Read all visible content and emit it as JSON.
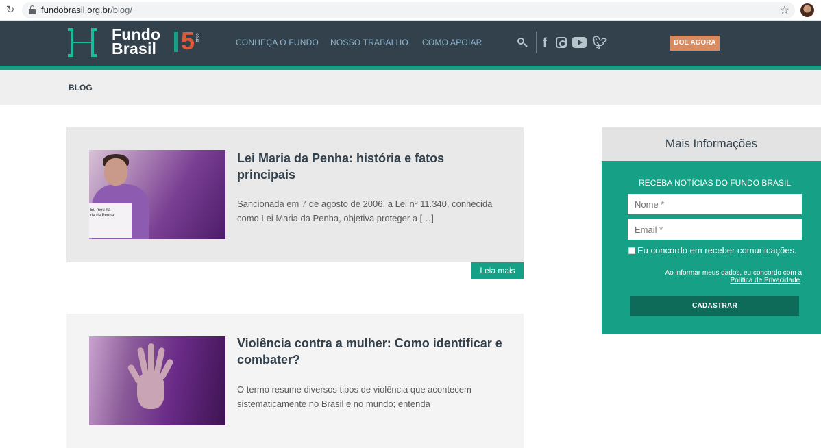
{
  "browser": {
    "url_host": "fundobrasil.org.br",
    "url_path": "/blog/"
  },
  "header": {
    "logo_line1": "Fundo",
    "logo_line2": "Brasil",
    "logo_years": "15",
    "logo_anos": "anos",
    "nav": [
      "CONHEÇA O FUNDO",
      "NOSSO TRABALHO",
      "COMO APOIAR"
    ],
    "social_icons": [
      "facebook-icon",
      "instagram-icon",
      "youtube-icon",
      "twitter-icon"
    ],
    "donate_label": "DOE AGORA"
  },
  "breadcrumb": {
    "label": "BLOG"
  },
  "posts": [
    {
      "title": "Lei Maria da Penha: história e fatos principais",
      "excerpt": " Sancionada em 7 de agosto de 2006, a Lei nº 11.340, conhecida como Lei Maria da Penha, objetiva proteger a […]",
      "thumb_sign": "Eu meu na\nria da Penha!",
      "read_more": "Leia mais"
    },
    {
      "title": "Violência contra a mulher: Como identificar e combater?",
      "excerpt": "O termo resume diversos tipos de violência que acontecem sistematicamente no Brasil e no mundo; entenda"
    }
  ],
  "sidebar": {
    "heading": "Mais Informações",
    "newsletter_title": "RECEBA NOTÍCIAS DO FUNDO BRASIL",
    "name_placeholder": "Nome *",
    "email_placeholder": "Email *",
    "consent_label": "Eu concordo em receber comunicações.",
    "privacy_text": "Ao informar meus dados, eu concordo com a",
    "privacy_link": "Política de Privacidade",
    "privacy_suffix": ".",
    "submit_label": "CADASTRAR"
  },
  "colors": {
    "header_bg": "#33414c",
    "accent": "#16a085",
    "donate": "#d98b5f",
    "nav_text": "#8cb4cc"
  }
}
